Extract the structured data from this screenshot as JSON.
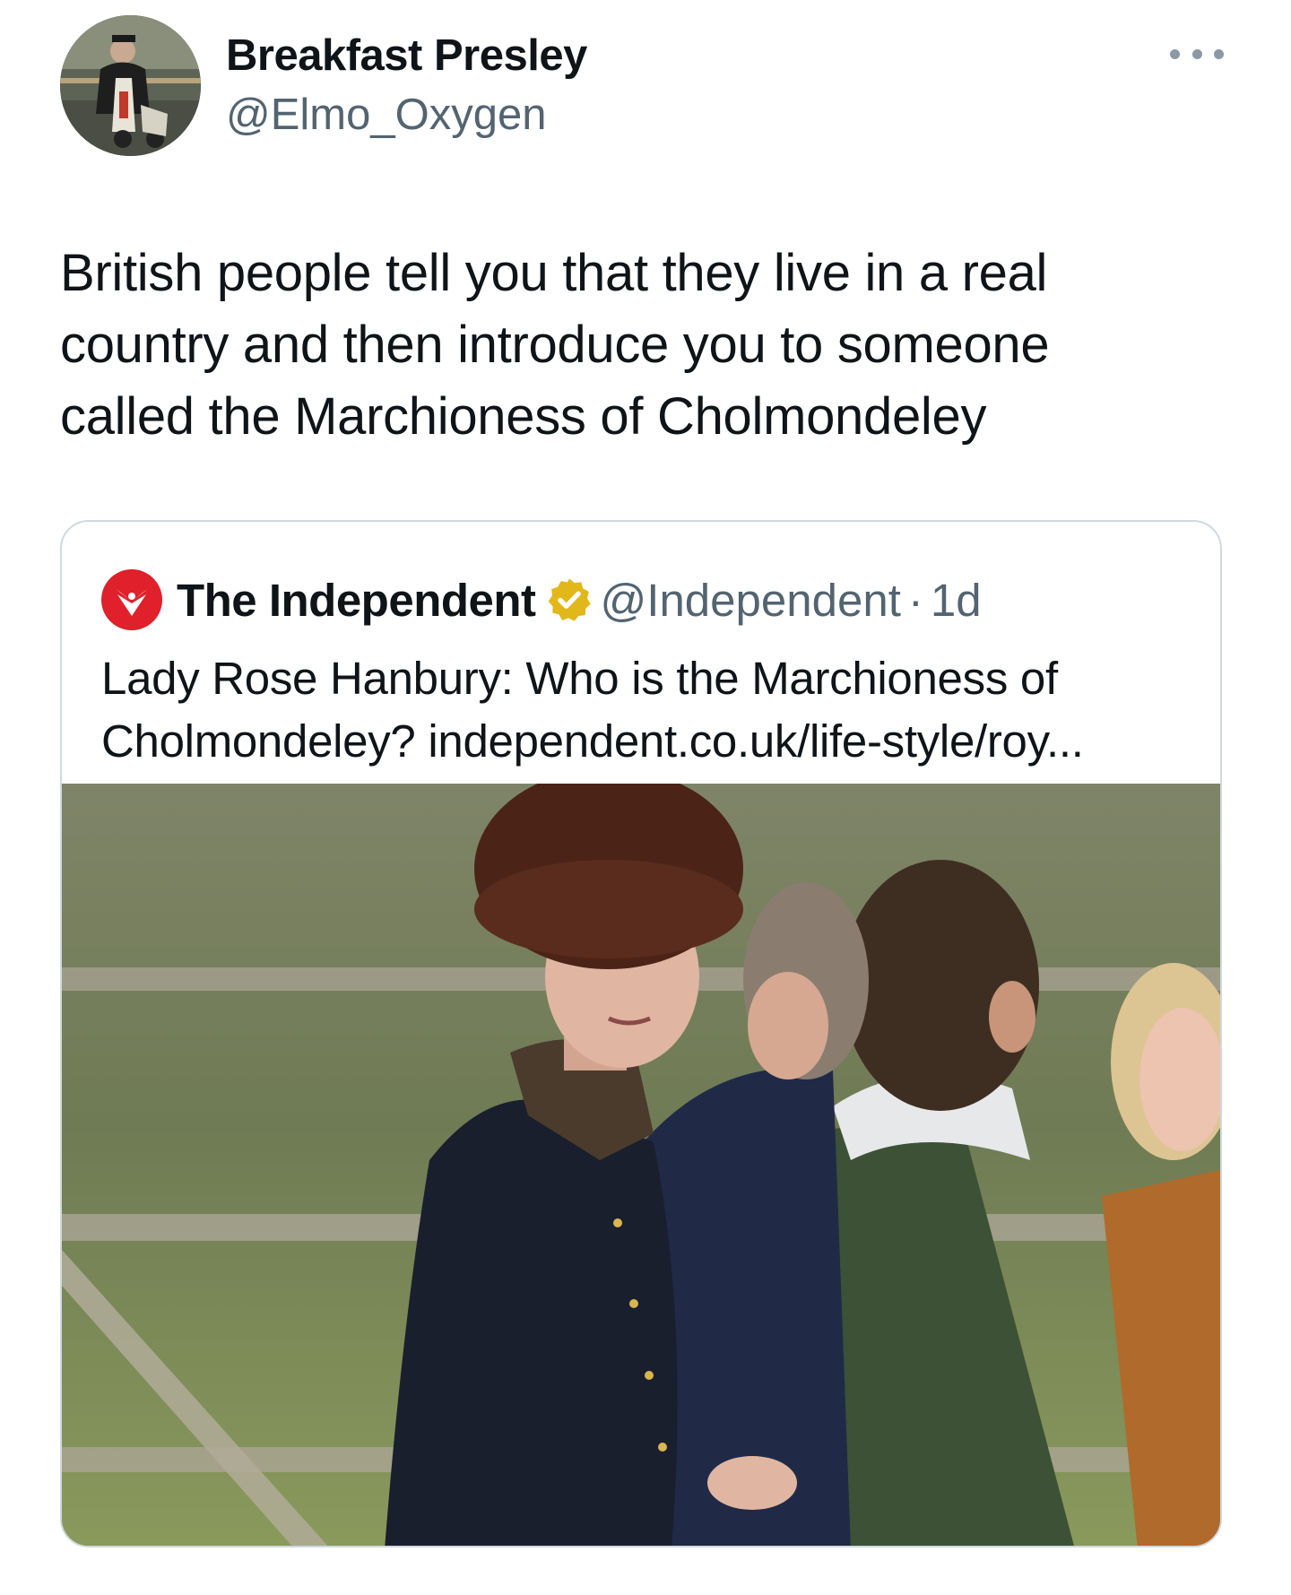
{
  "tweet": {
    "author": {
      "display_name": "Breakfast Presley",
      "handle": "@Elmo_Oxygen",
      "avatar_icon": "scooter-rider-avatar"
    },
    "more_icon": "ellipsis-icon",
    "text": "British people tell you that they live in a real\ncountry and then introduce you to someone\ncalled the Marchioness of Cholmondeley"
  },
  "quote": {
    "logo_icon": "independent-eagle-logo",
    "name": "The Independent",
    "verified_icon": "gold-verified-badge-icon",
    "handle": "@Independent",
    "separator": "·",
    "time": "1d",
    "text": "Lady Rose Hanbury: Who is the Marchioness of\nCholmondeley? independent.co.uk/life-style/roy...",
    "photo_description_icon": "photo-woman-fur-hat"
  },
  "colors": {
    "text_primary": "#0f1419",
    "text_secondary": "#536471",
    "card_border": "#cfd9de",
    "independent_red": "#e0202b",
    "verified_gold": "#e2b719"
  }
}
